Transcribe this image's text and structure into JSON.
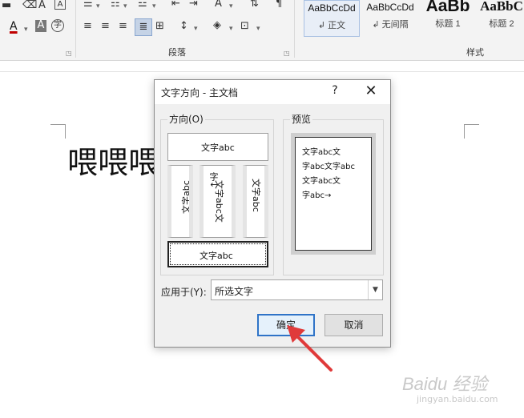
{
  "ribbon": {
    "paragraph_group_label": "段落",
    "styles_group_label": "样式",
    "font_color_letter": "A",
    "char_shade_letter": "A",
    "enclose_char": "字",
    "styles": [
      {
        "sample": "AaBbCcDd",
        "name": "↲ 正文"
      },
      {
        "sample": "AaBbCcDd",
        "name": "↲ 无间隔"
      },
      {
        "sample": "AaBb",
        "name": "标题 1"
      },
      {
        "sample": "AaBbC",
        "name": "标题 2"
      }
    ],
    "colors": {
      "font_color": "#c00000",
      "accent": "#2f73c7"
    }
  },
  "document": {
    "text": "喂喂喂"
  },
  "dialog": {
    "title": "文字方向 - 主文档",
    "help": "?",
    "close": "✕",
    "orientation_label": "方向(O)",
    "preview_label": "预览",
    "orientations": {
      "horizontal": "文字abc",
      "vertical_left": "文字abc",
      "vertical_stacked": "文字abc文",
      "stacked_chars": "字↓",
      "vertical_right": "文字abc",
      "rotated_bottom": "文字abc"
    },
    "preview_lines": [
      "文字abc文",
      "字abc文字abc",
      "文字abc文",
      "字abc→"
    ],
    "apply_to_label": "应用于(Y):",
    "apply_to_value": "所选文字",
    "ok_label": "确定",
    "cancel_label": "取消"
  },
  "watermark": {
    "brand": "Baidu 经验",
    "url": "jingyan.baidu.com"
  }
}
